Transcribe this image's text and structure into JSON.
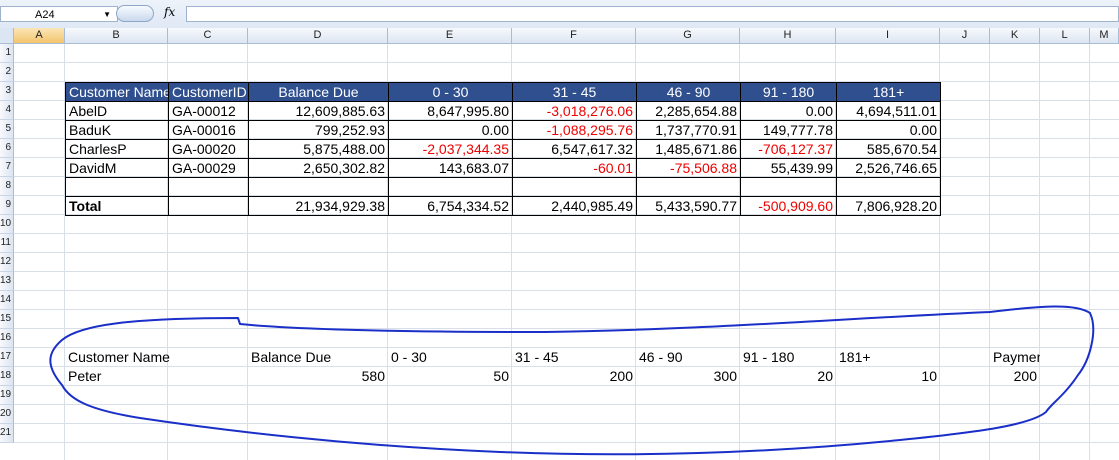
{
  "formula_bar": {
    "name_box": "A24",
    "fx_label": "fx",
    "formula": ""
  },
  "columns": [
    "A",
    "B",
    "C",
    "D",
    "E",
    "F",
    "G",
    "H",
    "I",
    "J",
    "K",
    "L",
    "M"
  ],
  "rows": [
    "1",
    "2",
    "3",
    "4",
    "5",
    "6",
    "7",
    "8",
    "9",
    "10",
    "11",
    "12",
    "13",
    "14",
    "15",
    "16",
    "17",
    "18",
    "19",
    "20",
    "21"
  ],
  "table": {
    "headers": [
      "Customer Name",
      "CustomerID",
      "Balance Due",
      "0 - 30",
      "31 - 45",
      "46 - 90",
      "91 - 180",
      "181+"
    ],
    "rows": [
      [
        "AbelD",
        "GA-00012",
        "12,609,885.63",
        "8,647,995.80",
        "-3,018,276.06",
        "2,285,654.88",
        "0.00",
        "4,694,511.01"
      ],
      [
        "BaduK",
        "GA-00016",
        "799,252.93",
        "0.00",
        "-1,088,295.76",
        "1,737,770.91",
        "149,777.78",
        "0.00"
      ],
      [
        "CharlesP",
        "GA-00020",
        "5,875,488.00",
        "-2,037,344.35",
        "6,547,617.32",
        "1,485,671.86",
        "-706,127.37",
        "585,670.54"
      ],
      [
        "DavidM",
        "GA-00029",
        "2,650,302.82",
        "143,683.07",
        "-60.01",
        "-75,506.88",
        "55,439.99",
        "2,526,746.65"
      ]
    ],
    "total": [
      "Total",
      "",
      "21,934,929.38",
      "6,754,334.52",
      "2,440,985.49",
      "5,433,590.77",
      "-500,909.60",
      "7,806,928.20"
    ]
  },
  "lower": {
    "headers": [
      "Customer Name",
      "Balance Due",
      "0 - 30",
      "31 - 45",
      "46 - 90",
      "91 - 180",
      "181+",
      "Payment"
    ],
    "values": [
      "Peter",
      "580",
      "50",
      "200",
      "300",
      "20",
      "10",
      "200"
    ]
  },
  "colors": {
    "header_fill": "#2f4f8f",
    "negative": "#e00000",
    "annotation": "#1a2fc8"
  }
}
